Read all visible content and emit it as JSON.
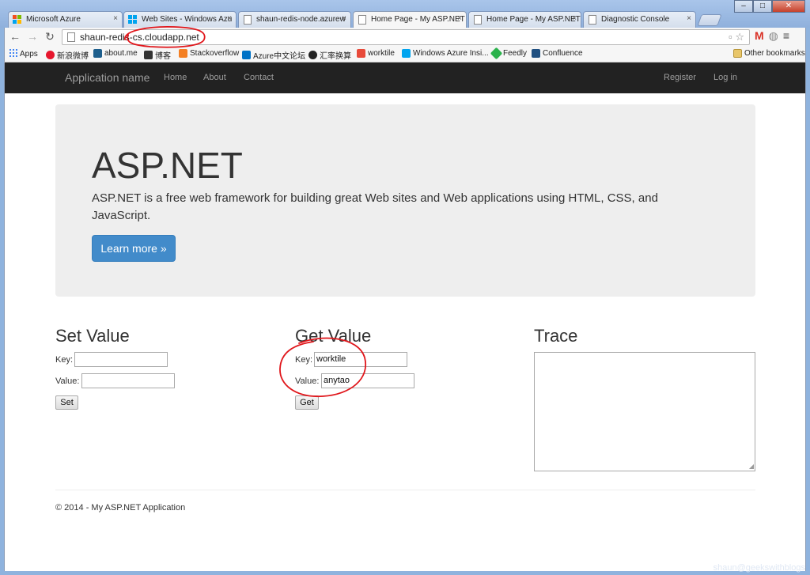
{
  "tabs": [
    {
      "label": "Microsoft Azure",
      "color": "#f25022"
    },
    {
      "label": "Web Sites - Windows Azu",
      "color": "#00a4ef"
    },
    {
      "label": "shaun-redis-node.azurew",
      "color": "#ffffff"
    },
    {
      "label": "Home Page - My ASP.NET",
      "color": "#ffffff"
    },
    {
      "label": "Home Page - My ASP.NET",
      "color": "#ffffff"
    },
    {
      "label": "Diagnostic Console",
      "color": "#ffffff"
    }
  ],
  "tab_close_glyph": "×",
  "window_controls": {
    "minimize": "–",
    "maximize": "□",
    "close": "✕"
  },
  "nav": {
    "back": "←",
    "forward": "→",
    "reload": "↻"
  },
  "address_bar": {
    "url": "shaun-redis-cs.cloudapp.net"
  },
  "omni_icons": {
    "page_action": "▫",
    "star": "☆"
  },
  "extensions": {
    "gmail": "M",
    "globe": "◍",
    "menu": "≡"
  },
  "bookmarks": [
    {
      "label": "Apps",
      "color": "#4285f4"
    },
    {
      "label": "新浪微博",
      "color": "#e6162d"
    },
    {
      "label": "about.me",
      "color": "#1d5e8c"
    },
    {
      "label": "博客",
      "color": "#333333"
    },
    {
      "label": "Stackoverflow",
      "color": "#f48024"
    },
    {
      "label": "Azure中文论坛",
      "color": "#0072c6"
    },
    {
      "label": "汇率换算",
      "color": "#222222"
    },
    {
      "label": "worktile",
      "color": "#e84a3a"
    },
    {
      "label": "Windows Azure Insi...",
      "color": "#00a4ef"
    },
    {
      "label": "Feedly",
      "color": "#2bb24c"
    },
    {
      "label": "Confluence",
      "color": "#205081"
    }
  ],
  "other_bookmarks": "Other bookmarks",
  "site": {
    "brand": "Application name",
    "nav_left": [
      "Home",
      "About",
      "Contact"
    ],
    "nav_right": [
      "Register",
      "Log in"
    ]
  },
  "jumbotron": {
    "title": "ASP.NET",
    "lead": "ASP.NET is a free web framework for building great Web sites and Web applications using HTML, CSS, and JavaScript.",
    "button": "Learn more »"
  },
  "set_value": {
    "title": "Set Value",
    "key_label": "Key:",
    "key_value": "",
    "value_label": "Value:",
    "value_value": "",
    "button": "Set"
  },
  "get_value": {
    "title": "Get Value",
    "key_label": "Key:",
    "key_value": "worktile",
    "value_label": "Value:",
    "value_value": "anytao",
    "button": "Get"
  },
  "trace": {
    "title": "Trace",
    "content": "",
    "grip": "◢"
  },
  "footer": "© 2014 - My ASP.NET Application",
  "watermark": "shaun@geekswithblogs",
  "colors": {
    "annotation": "#e0161b",
    "primary_button": "#428bca",
    "navbar": "#222222"
  }
}
